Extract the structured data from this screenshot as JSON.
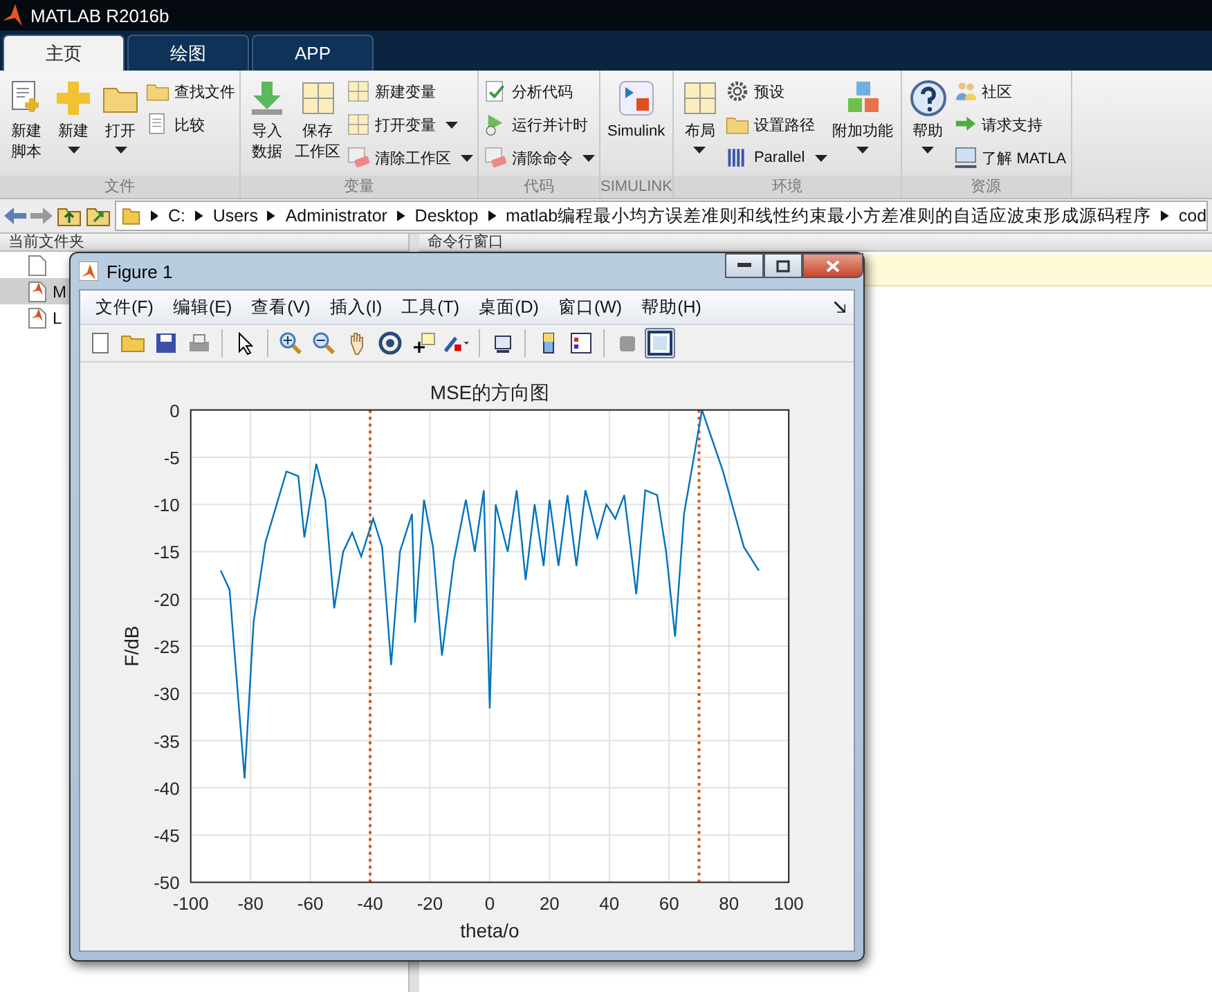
{
  "window": {
    "title": "MATLAB R2016b"
  },
  "tabs": [
    {
      "label": "主页",
      "selected": true
    },
    {
      "label": "绘图",
      "selected": false
    },
    {
      "label": "APP",
      "selected": false
    }
  ],
  "ribbon": {
    "groups": [
      {
        "label": "文件",
        "items": [
          {
            "kind": "large",
            "lines": [
              "新建",
              "脚本"
            ],
            "dropdown": false
          },
          {
            "kind": "large",
            "lines": [
              "新建"
            ],
            "dropdown": true
          },
          {
            "kind": "large",
            "lines": [
              "打开"
            ],
            "dropdown": true
          },
          {
            "kind": "stack",
            "entries": [
              {
                "label": "查找文件",
                "dropdown": false
              },
              {
                "label": "比较",
                "dropdown": false
              }
            ]
          }
        ]
      },
      {
        "label": "变量",
        "items": [
          {
            "kind": "large",
            "lines": [
              "导入",
              "数据"
            ],
            "dropdown": false
          },
          {
            "kind": "large",
            "lines": [
              "保存",
              "工作区"
            ],
            "dropdown": false
          },
          {
            "kind": "stack",
            "entries": [
              {
                "label": "新建变量",
                "dropdown": false
              },
              {
                "label": "打开变量",
                "dropdown": true
              },
              {
                "label": "清除工作区",
                "dropdown": true
              }
            ]
          }
        ]
      },
      {
        "label": "代码",
        "items": [
          {
            "kind": "stack",
            "entries": [
              {
                "label": "分析代码",
                "dropdown": false
              },
              {
                "label": "运行并计时",
                "dropdown": false
              },
              {
                "label": "清除命令",
                "dropdown": true
              }
            ]
          }
        ]
      },
      {
        "label": "SIMULINK",
        "items": [
          {
            "kind": "large",
            "lines": [
              "Simulink"
            ],
            "dropdown": false
          }
        ]
      },
      {
        "label": "环境",
        "items": [
          {
            "kind": "large",
            "lines": [
              "布局"
            ],
            "dropdown": true
          },
          {
            "kind": "stack",
            "entries": [
              {
                "label": "预设",
                "dropdown": false
              },
              {
                "label": "设置路径",
                "dropdown": false
              },
              {
                "label": "Parallel",
                "dropdown": true
              }
            ]
          },
          {
            "kind": "large",
            "lines": [
              "附加功能"
            ],
            "dropdown": true
          }
        ]
      },
      {
        "label": "资源",
        "items": [
          {
            "kind": "large",
            "lines": [
              "帮助"
            ],
            "dropdown": true
          },
          {
            "kind": "stack",
            "entries": [
              {
                "label": "社区",
                "dropdown": false
              },
              {
                "label": "请求支持",
                "dropdown": false
              },
              {
                "label": "了解 MATLA",
                "dropdown": false
              }
            ]
          }
        ]
      }
    ]
  },
  "address_bar": {
    "segments": [
      "C:",
      "Users",
      "Administrator",
      "Desktop",
      "matlab编程最小均方误差准则和线性约束最小方差准则的自适应波束形成源码程序",
      "cod"
    ]
  },
  "current_folder": {
    "title": "当前文件夹",
    "rows": [
      {
        "name": "M",
        "selected": true
      },
      {
        "name": "L",
        "selected": false
      }
    ]
  },
  "command_window": {
    "title": "命令行窗口"
  },
  "figure": {
    "title": "Figure 1",
    "menus": [
      "文件(F)",
      "编辑(E)",
      "查看(V)",
      "插入(I)",
      "工具(T)",
      "桌面(D)",
      "窗口(W)",
      "帮助(H)"
    ],
    "toolbar": [
      {
        "pressed": false
      },
      {
        "pressed": false
      },
      {
        "pressed": false
      },
      {
        "pressed": false
      },
      {
        "pressed": false
      },
      {
        "pressed": false
      },
      {
        "pressed": false
      },
      {
        "pressed": false
      },
      {
        "pressed": false
      },
      {
        "pressed": false
      },
      {
        "pressed": false
      },
      {
        "pressed": false
      },
      {
        "pressed": false
      },
      {
        "pressed": false
      },
      {
        "pressed": false
      },
      {
        "pressed": true
      }
    ],
    "chart_data": {
      "type": "line",
      "title": "MSE的方向图",
      "xlabel": "theta/o",
      "ylabel": "F/dB",
      "x": [
        -90,
        -87,
        -82,
        -79,
        -75,
        -68,
        -64,
        -62,
        -58,
        -55,
        -52,
        -49,
        -46,
        -43,
        -39,
        -36,
        -33,
        -30,
        -26,
        -25,
        -22,
        -19,
        -16,
        -12,
        -8,
        -5,
        -2,
        0,
        2,
        6,
        9,
        12,
        15,
        18,
        20,
        23,
        26,
        29,
        32,
        36,
        39,
        42,
        45,
        49,
        52,
        56,
        59,
        62,
        65,
        71,
        78,
        85,
        90
      ],
      "series": [
        {
          "color": "#0072bd",
          "values": [
            -17,
            -19,
            -39,
            -22.5,
            -14,
            -6.5,
            -7,
            -13.5,
            -5.7,
            -9.5,
            -21,
            -15,
            -13,
            -15.5,
            -11.5,
            -14.5,
            -27,
            -15,
            -11,
            -22.5,
            -9.5,
            -14.5,
            -26,
            -16,
            -9.5,
            -15,
            -8.5,
            -31.6,
            -10,
            -15,
            -8.5,
            -18,
            -10,
            -16.5,
            -9.5,
            -16.5,
            -9,
            -16.5,
            -8.5,
            -13.5,
            -10,
            -11.5,
            -9,
            -19.5,
            -8.5,
            -9,
            -15,
            -24,
            -11,
            0,
            -6.5,
            -14.5,
            -17
          ]
        }
      ],
      "xlim": [
        -100,
        100
      ],
      "ylim": [
        -50,
        0
      ],
      "xticks": [
        -100,
        -80,
        -60,
        -40,
        -20,
        0,
        20,
        40,
        60,
        80,
        100
      ],
      "yticks": [
        -50,
        -45,
        -40,
        -35,
        -30,
        -25,
        -20,
        -15,
        -10,
        -5,
        0
      ],
      "grid": true,
      "ref_lines": [
        {
          "axis": "x",
          "value": -40
        },
        {
          "axis": "x",
          "value": 70
        }
      ]
    }
  }
}
